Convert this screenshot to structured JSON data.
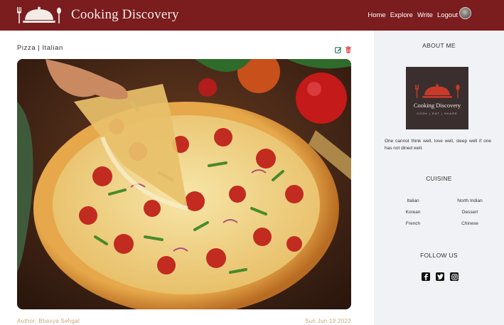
{
  "header": {
    "brand_title": "Cooking Discovery",
    "nav": {
      "home": "Home",
      "explore": "Explore",
      "write": "Write",
      "logout": "Logout"
    }
  },
  "post": {
    "category": "Pizza",
    "separator": "|",
    "cuisine": "Italian",
    "author": "Author: Bhavya Sehgal",
    "date": "Sun Jun 19 2022"
  },
  "sidebar": {
    "about_title": "ABOUT ME",
    "logo": {
      "title": "Cooking Discovery",
      "subtitle": "COOK | EAT | SHARE"
    },
    "about_text": "One cannot think well, love well, sleep well if one has not dined well.",
    "cuisine_title": "CUISINE",
    "cuisines": [
      "Italian",
      "North Indian",
      "Korean",
      "Dessert",
      "French",
      "Chinese"
    ],
    "follow_title": "FOLLOW US"
  },
  "colors": {
    "header_bg": "#7b1c1e",
    "edit_icon": "#2e7d5b",
    "delete_icon": "#e04040",
    "footer_text": "#c9a578"
  }
}
